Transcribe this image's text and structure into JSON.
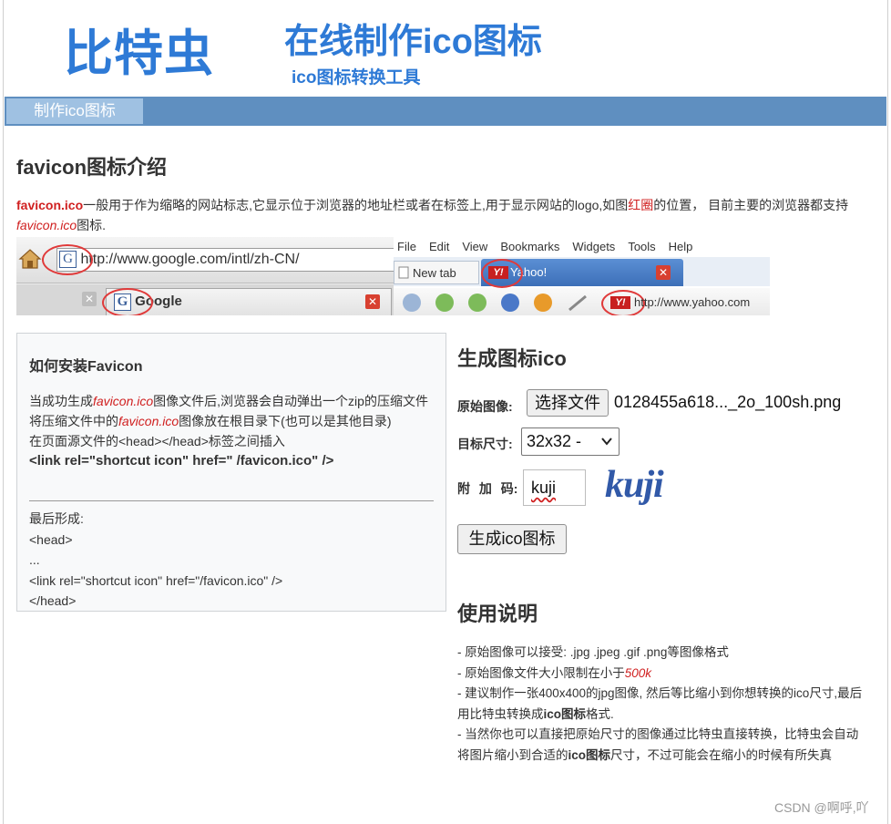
{
  "header": {
    "site_name": "比特虫",
    "title": "在线制作ico图标",
    "subtitle": "ico图标转换工具"
  },
  "nav": {
    "tab_label": "制作ico图标"
  },
  "favicon_intro": {
    "heading": "favicon图标介绍",
    "p_part1": "favicon.ico",
    "p_part2": "一般用于作为缩略的网站标志,它显示位于浏览器的地址栏或者在标签上,用于显示网站的logo,如图",
    "p_red": "红圈",
    "p_part3": "的位置， 目前主要的浏览器都支持",
    "p_italic": "favicon.ico",
    "p_part4": "图标."
  },
  "example_screenshot": {
    "ff_url": "http://www.google.com/intl/zh-CN/",
    "ff_tab": "Google",
    "ie_menu": [
      "File",
      "Edit",
      "View",
      "Bookmarks",
      "Widgets",
      "Tools",
      "Help"
    ],
    "ie_tab_new": "New tab",
    "ie_tab_active": "Yahoo!",
    "ie_url": "http://www.yahoo.com"
  },
  "install_box": {
    "heading": "如何安装Favicon",
    "line1_a": "当成功生成",
    "line1_italic": "favicon.ico",
    "line1_b": "图像文件后,浏览器会自动弹出一个zip的压缩文件",
    "line2_a": "将压缩文件中的",
    "line2_italic": "favicon.ico",
    "line2_b": "图像放在根目录下(也可以是其他目录)",
    "line3": "在页面源文件的<head></head>标签之间插入",
    "code": "<link rel=\"shortcut icon\" href=\" /favicon.ico\" />",
    "final_lines": [
      "最后形成:",
      "<head>",
      "...",
      "<link rel=\"shortcut icon\" href=\"/favicon.ico\" />",
      "</head>"
    ]
  },
  "generate": {
    "heading": "生成图标ico",
    "source_label": "原始图像:",
    "file_button": "选择文件",
    "file_name": "0128455a618..._2o_100sh.png",
    "size_label": "目标尺寸:",
    "size_value": "32x32 -",
    "code_label": "附 加 码:",
    "code_value": "kuji",
    "captcha_text": "kuji",
    "submit": "生成ico图标"
  },
  "usage": {
    "heading": "使用说明",
    "l1": "- 原始图像可以接受: .jpg .jpeg .gif .png等图像格式",
    "l2_a": "- 原始图像文件大小限制在小于",
    "l2_red": "500k",
    "l3_a": "- 建议制作一张400x400的jpg图像, 然后等比缩小到你想转换的ico尺寸,最后用比特虫转换成",
    "l3_bold": "ico图标",
    "l3_b": "格式.",
    "l4_a": "- 当然你也可以直接把原始尺寸的图像通过比特虫直接转换，比特虫会自动将图片缩小到合适的",
    "l4_bold": "ico图标",
    "l4_b": "尺寸，不过可能会在缩小的时候有所失真"
  },
  "watermark": "CSDN @啊呼,吖"
}
